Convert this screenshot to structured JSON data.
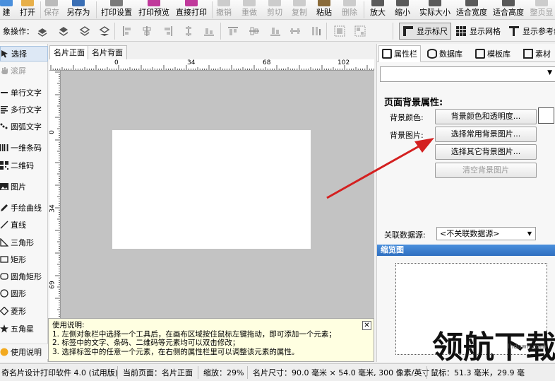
{
  "toolbar": {
    "buttons": [
      {
        "label": "建",
        "disabled": false
      },
      {
        "label": "打开",
        "disabled": false
      },
      {
        "label": "保存",
        "disabled": true
      },
      {
        "label": "另存为",
        "disabled": false
      },
      {
        "label": "打印设置",
        "disabled": false
      },
      {
        "label": "打印预览",
        "disabled": false
      },
      {
        "label": "直接打印",
        "disabled": false
      },
      {
        "label": "撤销",
        "disabled": true
      },
      {
        "label": "重做",
        "disabled": true
      },
      {
        "label": "剪切",
        "disabled": true
      },
      {
        "label": "复制",
        "disabled": true
      },
      {
        "label": "粘贴",
        "disabled": false
      },
      {
        "label": "删除",
        "disabled": true
      },
      {
        "label": "放大",
        "disabled": false
      },
      {
        "label": "缩小",
        "disabled": false
      },
      {
        "label": "实际大小",
        "disabled": false
      },
      {
        "label": "适合宽度",
        "disabled": false
      },
      {
        "label": "适合高度",
        "disabled": false
      },
      {
        "label": "整页显",
        "disabled": true
      }
    ]
  },
  "objbar": {
    "label": "象操作：",
    "show_ruler": "显示标尺",
    "show_grid": "显示网格",
    "show_guides": "显示参考线"
  },
  "tools": {
    "items": [
      {
        "label": "选择",
        "icon": "arrow-icon",
        "disabled": false
      },
      {
        "label": "滚屏",
        "icon": "hand-icon",
        "disabled": true
      },
      {
        "label": "单行文字",
        "icon": "single-line-text-icon",
        "disabled": false
      },
      {
        "label": "多行文字",
        "icon": "multi-line-text-icon",
        "disabled": false
      },
      {
        "label": "圆弧文字",
        "icon": "arc-text-icon",
        "disabled": false
      },
      {
        "label": "一维条码",
        "icon": "barcode-icon",
        "disabled": false
      },
      {
        "label": "二维码",
        "icon": "qrcode-icon",
        "disabled": false
      },
      {
        "label": "图片",
        "icon": "image-icon",
        "disabled": false
      },
      {
        "label": "手绘曲线",
        "icon": "pencil-icon",
        "disabled": false
      },
      {
        "label": "直线",
        "icon": "line-icon",
        "disabled": false
      },
      {
        "label": "三角形",
        "icon": "triangle-icon",
        "disabled": false
      },
      {
        "label": "矩形",
        "icon": "rectangle-icon",
        "disabled": false
      },
      {
        "label": "圆角矩形",
        "icon": "rounded-rectangle-icon",
        "disabled": false
      },
      {
        "label": "圆形",
        "icon": "circle-icon",
        "disabled": false
      },
      {
        "label": "菱形",
        "icon": "diamond-icon",
        "disabled": false
      },
      {
        "label": "五角星",
        "icon": "star-icon",
        "disabled": false
      }
    ],
    "help_label": "使用说明"
  },
  "canvas": {
    "tabs": [
      "名片正面",
      "名片背面"
    ],
    "ruler_h_labels": [
      "0",
      "34",
      "68",
      "102"
    ],
    "ruler_v_labels": [
      "0",
      "34",
      "69"
    ]
  },
  "help": {
    "title": "使用说明:",
    "lines": [
      "1. 左侧对象栏中选择一个工具后，在画布区域按住鼠标左键拖动，即可添加一个元素；",
      "2. 标签中的文字、条码、二维码等元素均可以双击修改；",
      "3. 选择标签中的任意一个元素，在右侧的属性栏里可以调整该元素的属性。"
    ],
    "close": "✕"
  },
  "rightpanel": {
    "tabs": [
      "属性栏",
      "数据库",
      "模板库",
      "素材"
    ],
    "title": "页面背景属性:",
    "bg_color_label": "背景颜色:",
    "bg_color_button": "背景颜色和透明度...",
    "bg_image_label": "背景图片:",
    "common_bg_button": "选择常用背景图片...",
    "other_bg_button": "选择其它背景图片...",
    "clear_bg_button": "清空背景图片",
    "datasource_label": "关联数据源:",
    "datasource_value": "<不关联数据源>",
    "preview_title": "缩览图",
    "colors": {
      "accent": "#2f6fc0",
      "swatch": "#ffffff",
      "arrow": "#d42020"
    }
  },
  "status": {
    "app": "奇名片设计打印软件 4.0 (试用版)",
    "page": "当前页面：名片正面",
    "zoom": "缩放：29%",
    "size": "名片尺寸：90.0 毫米 × 54.0 毫米, 300 像素/英寸",
    "pos": "鼠标：51.3 毫米，29.9 毫"
  },
  "watermark": {
    "text": "领航下载",
    "url": "lhdown.com"
  }
}
